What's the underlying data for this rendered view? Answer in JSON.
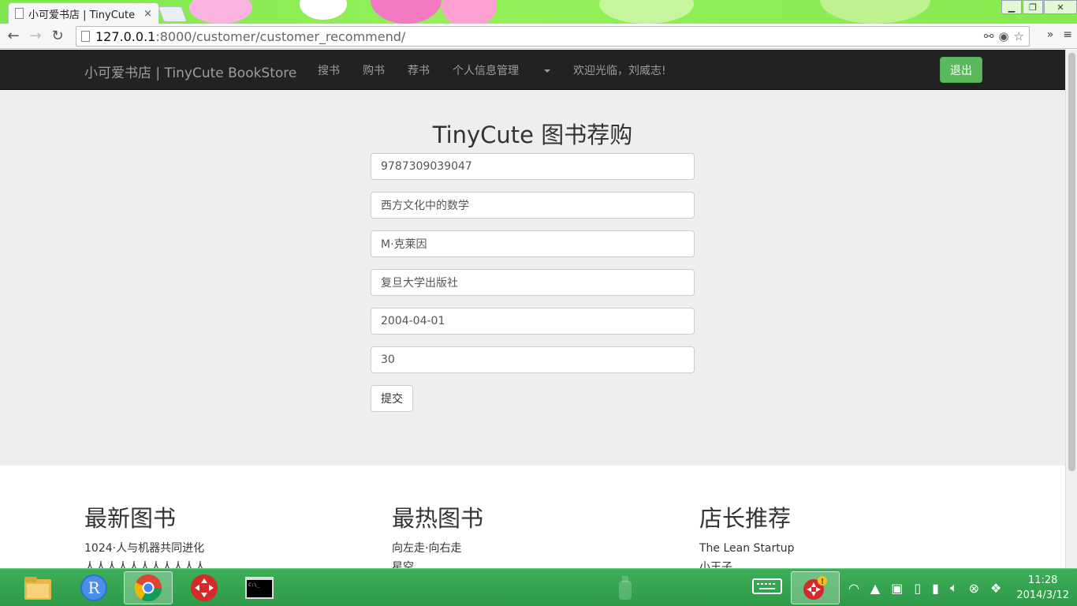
{
  "browser": {
    "tab_title": "小可爱书店 | TinyCute BookStore",
    "tab_close": "×",
    "url_host": "127.0.0.1",
    "url_path": ":8000/customer/customer_recommend/",
    "back": "←",
    "forward": "→",
    "reload": "↻",
    "more": "»",
    "menu": "≡",
    "star": "☆"
  },
  "navbar": {
    "brand": "小可爱书店 | TinyCute BookStore",
    "links": [
      "搜书",
      "购书",
      "荐书"
    ],
    "dropdown": "个人信息管理",
    "welcome": "欢迎光临，刘威志!",
    "logout": "退出"
  },
  "form": {
    "title": "TinyCute 图书荐购",
    "fields": [
      "9787309039047",
      "西方文化中的数学",
      "M·克莱因",
      "复旦大学出版社",
      "2004-04-01",
      "30"
    ],
    "submit": "提交"
  },
  "sections": {
    "newest": {
      "title": "最新图书",
      "items": [
        "1024·人与机器共同进化",
        "人人人人人人人人人人人"
      ]
    },
    "hottest": {
      "title": "最热图书",
      "items": [
        "向左走·向右走",
        "星空"
      ]
    },
    "recommended": {
      "title": "店长推荐",
      "items": [
        "The Lean Startup",
        "小王子"
      ]
    }
  },
  "taskbar": {
    "time": "11:28",
    "date": "2014/3/12"
  }
}
